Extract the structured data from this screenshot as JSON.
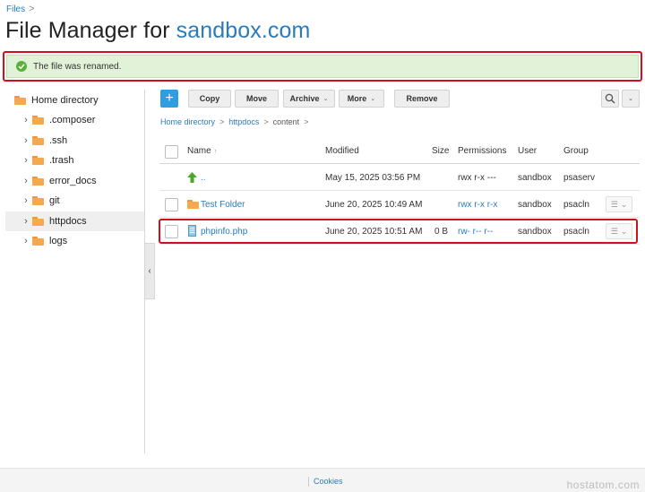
{
  "breadcrumb": {
    "root": "Files",
    "separator": ">"
  },
  "header": {
    "title_prefix": "File Manager for ",
    "domain": "sandbox.com"
  },
  "alert": {
    "message": "The file was renamed.",
    "icon": "check-circle-icon"
  },
  "sidebar": {
    "items": [
      {
        "label": "Home directory",
        "expandable": false
      },
      {
        "label": ".composer",
        "expandable": true
      },
      {
        "label": ".ssh",
        "expandable": true
      },
      {
        "label": ".trash",
        "expandable": true
      },
      {
        "label": "error_docs",
        "expandable": true
      },
      {
        "label": "git",
        "expandable": true
      },
      {
        "label": "httpdocs",
        "expandable": true,
        "active": true
      },
      {
        "label": "logs",
        "expandable": true
      }
    ]
  },
  "toolbar": {
    "add_label": "+",
    "copy_label": "Copy",
    "move_label": "Move",
    "archive_label": "Archive",
    "more_label": "More",
    "remove_label": "Remove"
  },
  "path": {
    "home": "Home directory",
    "parent": "httpdocs",
    "current": "content",
    "separator": ">"
  },
  "table": {
    "headers": {
      "name": "Name",
      "modified": "Modified",
      "size": "Size",
      "permissions": "Permissions",
      "user": "User",
      "group": "Group"
    },
    "rows": [
      {
        "name": "..",
        "modified": "May 15, 2025 03:56 PM",
        "size": "",
        "permissions": "rwx r-x ---",
        "user": "sandbox",
        "group": "psaserv",
        "icon": "up-arrow-icon"
      },
      {
        "name": "Test Folder",
        "modified": "June 20, 2025 10:49 AM",
        "size": "",
        "permissions": "rwx r-x r-x",
        "user": "sandbox",
        "group": "psacln",
        "icon": "folder-icon"
      },
      {
        "name": "phpinfo.php",
        "modified": "June 20, 2025 10:51 AM",
        "size": "0 B",
        "permissions": "rw- r-- r--",
        "user": "sandbox",
        "group": "psacln",
        "icon": "file-icon"
      }
    ]
  },
  "footer": {
    "cookies": "Cookies"
  },
  "watermark": "hostatom.com",
  "colors": {
    "accent": "#2b7bb9",
    "primary_button": "#2d9ee0",
    "success_bg": "#e2f2d9",
    "highlight_border": "#d0101c",
    "folder": "#f6a84e"
  }
}
